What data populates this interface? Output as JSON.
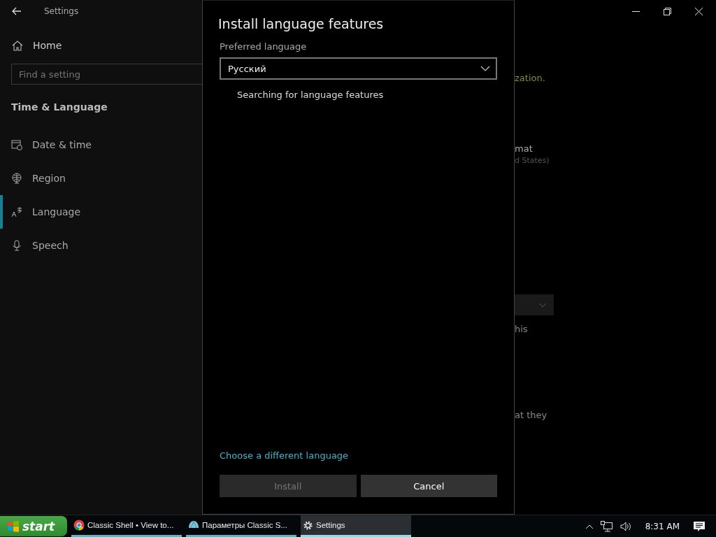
{
  "window": {
    "title": "Settings"
  },
  "sidebar": {
    "home": "Home",
    "search": {
      "placeholder": "Find a setting"
    },
    "section": "Time & Language",
    "items": [
      {
        "label": "Date & time",
        "kind": "calendar",
        "selected": false
      },
      {
        "label": "Region",
        "kind": "globe",
        "selected": false
      },
      {
        "label": "Language",
        "kind": "language",
        "selected": true
      },
      {
        "label": "Speech",
        "kind": "microphone",
        "selected": false
      }
    ]
  },
  "background": [
    {
      "kind": "link",
      "text": "zation."
    },
    {
      "kind": "text",
      "text": "mat"
    },
    {
      "kind": "subtext",
      "text": "d States)"
    },
    {
      "kind": "dropdown"
    },
    {
      "kind": "text",
      "text": "his"
    },
    {
      "kind": "text",
      "text": "at they"
    }
  ],
  "dialog": {
    "title": "Install language features",
    "field_label": "Preferred language",
    "dropdown": {
      "value": "Русский"
    },
    "status": "Searching for language features",
    "link": "Choose a different language",
    "buttons": [
      {
        "label": "Install",
        "disabled": true
      },
      {
        "label": "Cancel",
        "disabled": false
      }
    ]
  },
  "taskbar": {
    "start": "start",
    "tasks": [
      {
        "label": "Classic Shell • View to...",
        "kind": "browser",
        "selected": false
      },
      {
        "label": "Параметры Classic S...",
        "kind": "shell",
        "selected": false
      },
      {
        "label": "Settings",
        "kind": "gear",
        "selected": true
      }
    ],
    "clock": "8:31 AM"
  }
}
